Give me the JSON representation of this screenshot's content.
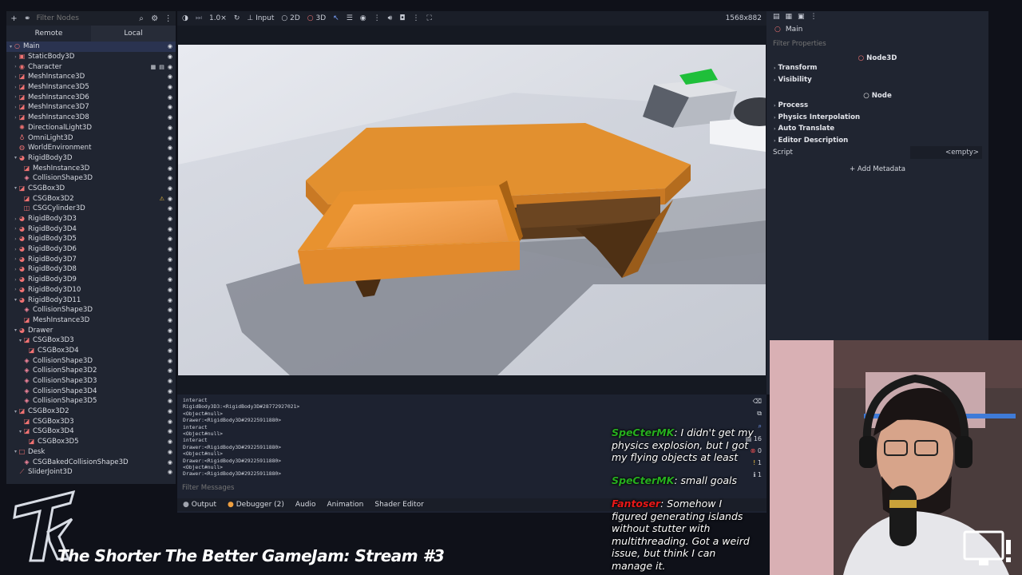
{
  "scene_dock": {
    "filter_placeholder": "Filter Nodes",
    "tabs": [
      "Remote",
      "Local"
    ],
    "active_tab": "Local",
    "nodes": [
      {
        "label": "Main",
        "depth": 0,
        "arrow": "▾",
        "icon": "○",
        "icon_color": "#f07272",
        "selected": true
      },
      {
        "label": "StaticBody3D",
        "depth": 1,
        "arrow": "›",
        "icon": "▣",
        "icon_color": "#f07272"
      },
      {
        "label": "Character",
        "depth": 1,
        "arrow": "›",
        "icon": "◉",
        "icon_color": "#f07272",
        "extra": true
      },
      {
        "label": "MeshInstance3D",
        "depth": 1,
        "arrow": "›",
        "icon": "◪",
        "icon_color": "#f07272"
      },
      {
        "label": "MeshInstance3D5",
        "depth": 1,
        "arrow": "›",
        "icon": "◪",
        "icon_color": "#f07272"
      },
      {
        "label": "MeshInstance3D6",
        "depth": 1,
        "arrow": "›",
        "icon": "◪",
        "icon_color": "#f07272"
      },
      {
        "label": "MeshInstance3D7",
        "depth": 1,
        "arrow": "›",
        "icon": "◪",
        "icon_color": "#f07272"
      },
      {
        "label": "MeshInstance3D8",
        "depth": 1,
        "arrow": "›",
        "icon": "◪",
        "icon_color": "#f07272"
      },
      {
        "label": "DirectionalLight3D",
        "depth": 1,
        "arrow": "",
        "icon": "✺",
        "icon_color": "#f07272"
      },
      {
        "label": "OmniLight3D",
        "depth": 1,
        "arrow": "",
        "icon": "♁",
        "icon_color": "#f07272"
      },
      {
        "label": "WorldEnvironment",
        "depth": 1,
        "arrow": "",
        "icon": "◍",
        "icon_color": "#f07272"
      },
      {
        "label": "RigidBody3D",
        "depth": 1,
        "arrow": "▾",
        "icon": "◕",
        "icon_color": "#f07272"
      },
      {
        "label": "MeshInstance3D",
        "depth": 2,
        "arrow": "",
        "icon": "◪",
        "icon_color": "#f07272"
      },
      {
        "label": "CollisionShape3D",
        "depth": 2,
        "arrow": "",
        "icon": "◈",
        "icon_color": "#ff8aa0"
      },
      {
        "label": "CSGBox3D",
        "depth": 1,
        "arrow": "▾",
        "icon": "◪",
        "icon_color": "#f07272"
      },
      {
        "label": "CSGBox3D2",
        "depth": 2,
        "arrow": "",
        "icon": "◪",
        "icon_color": "#f07272",
        "warn": true
      },
      {
        "label": "CSGCylinder3D",
        "depth": 2,
        "arrow": "",
        "icon": "◫",
        "icon_color": "#f07272"
      },
      {
        "label": "RigidBody3D3",
        "depth": 1,
        "arrow": "›",
        "icon": "◕",
        "icon_color": "#f07272"
      },
      {
        "label": "RigidBody3D4",
        "depth": 1,
        "arrow": "›",
        "icon": "◕",
        "icon_color": "#f07272"
      },
      {
        "label": "RigidBody3D5",
        "depth": 1,
        "arrow": "›",
        "icon": "◕",
        "icon_color": "#f07272"
      },
      {
        "label": "RigidBody3D6",
        "depth": 1,
        "arrow": "›",
        "icon": "◕",
        "icon_color": "#f07272"
      },
      {
        "label": "RigidBody3D7",
        "depth": 1,
        "arrow": "›",
        "icon": "◕",
        "icon_color": "#f07272"
      },
      {
        "label": "RigidBody3D8",
        "depth": 1,
        "arrow": "›",
        "icon": "◕",
        "icon_color": "#f07272"
      },
      {
        "label": "RigidBody3D9",
        "depth": 1,
        "arrow": "›",
        "icon": "◕",
        "icon_color": "#f07272"
      },
      {
        "label": "RigidBody3D10",
        "depth": 1,
        "arrow": "›",
        "icon": "◕",
        "icon_color": "#f07272"
      },
      {
        "label": "RigidBody3D11",
        "depth": 1,
        "arrow": "▾",
        "icon": "◕",
        "icon_color": "#f07272"
      },
      {
        "label": "CollisionShape3D",
        "depth": 2,
        "arrow": "",
        "icon": "◈",
        "icon_color": "#ff8aa0"
      },
      {
        "label": "MeshInstance3D",
        "depth": 2,
        "arrow": "",
        "icon": "◪",
        "icon_color": "#f07272"
      },
      {
        "label": "Drawer",
        "depth": 1,
        "arrow": "▾",
        "icon": "◕",
        "icon_color": "#f07272"
      },
      {
        "label": "CSGBox3D3",
        "depth": 2,
        "arrow": "▾",
        "icon": "◪",
        "icon_color": "#f07272"
      },
      {
        "label": "CSGBox3D4",
        "depth": 3,
        "arrow": "",
        "icon": "◪",
        "icon_color": "#f07272"
      },
      {
        "label": "CollisionShape3D",
        "depth": 2,
        "arrow": "",
        "icon": "◈",
        "icon_color": "#ff8aa0"
      },
      {
        "label": "CollisionShape3D2",
        "depth": 2,
        "arrow": "",
        "icon": "◈",
        "icon_color": "#ff8aa0"
      },
      {
        "label": "CollisionShape3D3",
        "depth": 2,
        "arrow": "",
        "icon": "◈",
        "icon_color": "#ff8aa0"
      },
      {
        "label": "CollisionShape3D4",
        "depth": 2,
        "arrow": "",
        "icon": "◈",
        "icon_color": "#ff8aa0"
      },
      {
        "label": "CollisionShape3D5",
        "depth": 2,
        "arrow": "",
        "icon": "◈",
        "icon_color": "#ff8aa0"
      },
      {
        "label": "CSGBox3D2",
        "depth": 1,
        "arrow": "▾",
        "icon": "◪",
        "icon_color": "#f07272"
      },
      {
        "label": "CSGBox3D3",
        "depth": 2,
        "arrow": "",
        "icon": "◪",
        "icon_color": "#f07272"
      },
      {
        "label": "CSGBox3D4",
        "depth": 2,
        "arrow": "▾",
        "icon": "◪",
        "icon_color": "#f07272"
      },
      {
        "label": "CSGBox3D5",
        "depth": 3,
        "arrow": "",
        "icon": "◪",
        "icon_color": "#f07272"
      },
      {
        "label": "Desk",
        "depth": 1,
        "arrow": "▾",
        "icon": "□",
        "icon_color": "#f07272"
      },
      {
        "label": "CSGBakedCollisionShape3D",
        "depth": 2,
        "arrow": "",
        "icon": "◈",
        "icon_color": "#ff8aa0"
      },
      {
        "label": "SliderJoint3D",
        "depth": 1,
        "arrow": "",
        "icon": "⟋",
        "icon_color": "#f07272"
      }
    ]
  },
  "viewport": {
    "speed": "1.0×",
    "input": "Input",
    "mode_2d": "2D",
    "mode_3d": "3D",
    "resolution": "1568x882"
  },
  "output": {
    "log_lines": [
      "interact",
      "RigidBody3D3:<RigidBody3D#28772927021>",
      "<Object#null>",
      "Drawer:<RigidBody3D#29225911880>",
      "interact",
      "<Object#null>",
      "interact",
      "Drawer:<RigidBody3D#29225911880>",
      "<Object#null>",
      "Drawer:<RigidBody3D#29225911880>",
      "<Object#null>",
      "Drawer:<RigidBody3D#29225911880>"
    ],
    "filter_placeholder": "Filter Messages",
    "counts": {
      "messages": "16",
      "errors": "0",
      "warnings": "1",
      "info": "1"
    },
    "tabs": [
      "Output",
      "Debugger (2)",
      "Audio",
      "Animation",
      "Shader Editor"
    ]
  },
  "inspector": {
    "node_name": "Main",
    "filter_placeholder": "Filter Properties",
    "class_node3d": "Node3D",
    "node3d_sections": [
      "Transform",
      "Visibility"
    ],
    "class_node": "Node",
    "node_sections": [
      "Process",
      "Physics Interpolation",
      "Auto Translate",
      "Editor Description"
    ],
    "script_label": "Script",
    "script_value": "<empty>",
    "add_metadata": "Add Metadata"
  },
  "stream": {
    "title": "The Shorter The Better GameJam: Stream #3"
  },
  "chat": [
    {
      "user": "SpeCterMK",
      "text": ": I didn't get my physics explosion, but I got my flying objects at least",
      "color": "#27b01f"
    },
    {
      "user": "SpeCterMK",
      "text": ": small goals",
      "color": "#27b01f"
    },
    {
      "user": "Fantoser",
      "text": ": Somehow I figured generating islands without stutter with multithreading. Got a weird issue, but think I can manage it.",
      "color": "#e81818"
    }
  ]
}
